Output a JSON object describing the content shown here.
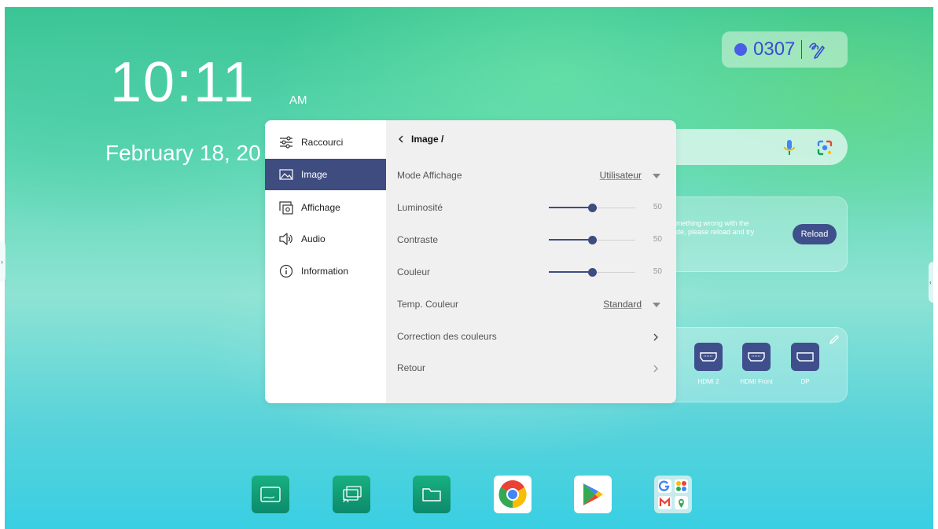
{
  "clock": {
    "time": "10:11",
    "ampm": "AM",
    "date": "February 18, 20"
  },
  "session": {
    "code": "0307",
    "dot_color": "#4a5de6"
  },
  "error_card": {
    "message": "mething wrong with the\nde, please reload and try",
    "reload_label": "Reload"
  },
  "sources": [
    {
      "label": "HDMI 2"
    },
    {
      "label": "HDMI Front"
    },
    {
      "label": "DP"
    }
  ],
  "settings": {
    "sidebar": [
      {
        "label": "Raccourci",
        "icon": "sliders-icon"
      },
      {
        "label": "Image",
        "icon": "image-icon",
        "active": true
      },
      {
        "label": "Affichage",
        "icon": "display-settings-icon"
      },
      {
        "label": "Audio",
        "icon": "speaker-icon"
      },
      {
        "label": "Information",
        "icon": "info-icon"
      }
    ],
    "header": "Image /",
    "rows": {
      "mode": {
        "label": "Mode Affichage",
        "value": "Utilisateur"
      },
      "luminosite": {
        "label": "Luminosité",
        "value": "50",
        "level": 50
      },
      "contraste": {
        "label": "Contraste",
        "value": "50",
        "level": 50
      },
      "couleur": {
        "label": "Couleur",
        "value": "50",
        "level": 50
      },
      "temp": {
        "label": "Temp. Couleur",
        "value": "Standard"
      },
      "correction": {
        "label": "Correction des couleurs"
      },
      "retour": {
        "label": "Retour"
      }
    },
    "accent_color": "#3e4c80"
  },
  "dock": [
    {
      "icon": "whiteboard-icon"
    },
    {
      "icon": "screen-cast-icon"
    },
    {
      "icon": "file-manager-icon"
    },
    {
      "icon": "chrome-icon"
    },
    {
      "icon": "play-store-icon"
    },
    {
      "icon": "google-apps-folder-icon"
    }
  ]
}
